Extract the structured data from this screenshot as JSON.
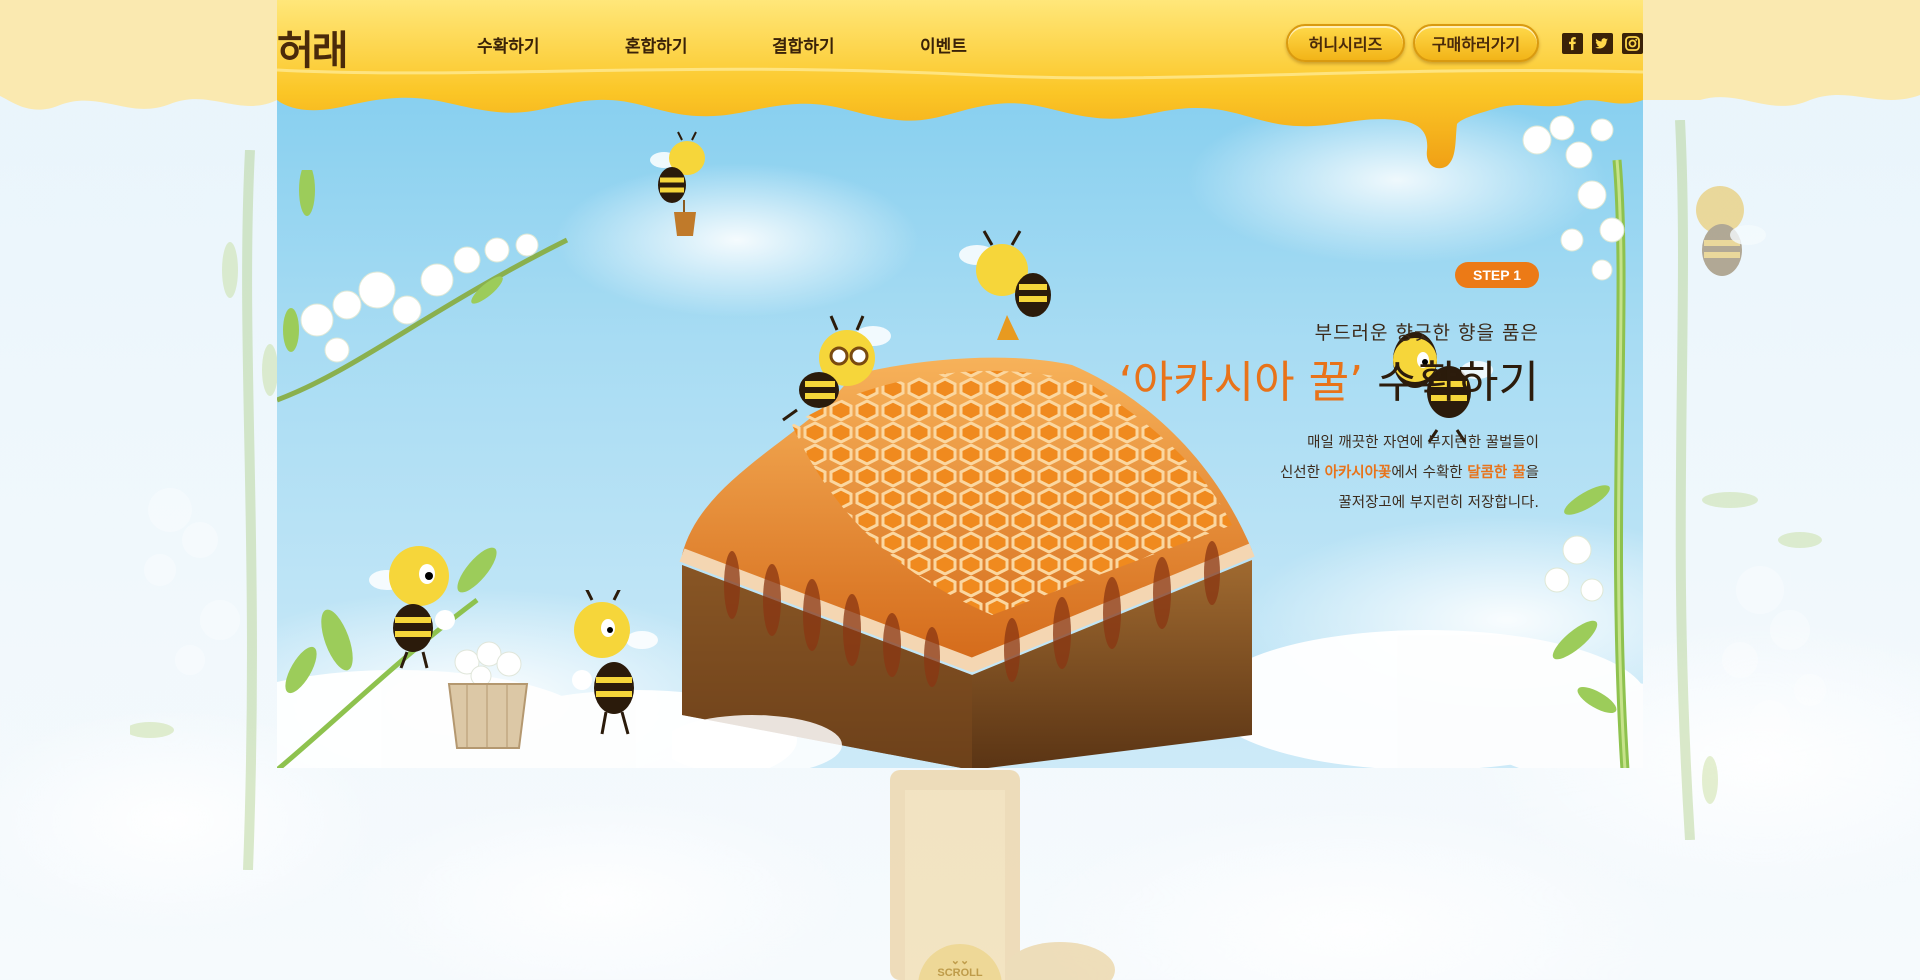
{
  "header": {
    "logo_text": "허래",
    "nav": [
      {
        "label": "수확하기"
      },
      {
        "label": "혼합하기"
      },
      {
        "label": "결합하기"
      },
      {
        "label": "이벤트"
      }
    ],
    "buttons": {
      "honey_series": "허니시리즈",
      "buy": "구매하러가기"
    },
    "social": [
      {
        "icon": "facebook-icon",
        "glyph": "f"
      },
      {
        "icon": "twitter-icon",
        "glyph": "t"
      },
      {
        "icon": "instagram-icon",
        "glyph": "ig"
      }
    ]
  },
  "hero": {
    "step": "STEP 1",
    "subtitle": "부드러운 향긋한 향을 품은",
    "title_quote": "‘아카시아 꿀’",
    "title_rest": "수확하기",
    "desc_line1": "매일 깨끗한 자연에 부지런한 꿀벌들이",
    "desc_line2_pre": "신선한 ",
    "desc_line2_hl1": "아카시아꽃",
    "desc_line2_mid": "에서 수확한 ",
    "desc_line2_hl2": "달콤한 꿀",
    "desc_line2_post": "을",
    "desc_line3": "꿀저장고에 부지런히 저장합니다."
  },
  "scroll": {
    "label": "SCROLL"
  },
  "colors": {
    "honey": "#f9c224",
    "honey_dark": "#e8961a",
    "accent": "#e8731a",
    "sky": "#8fd2f1"
  }
}
